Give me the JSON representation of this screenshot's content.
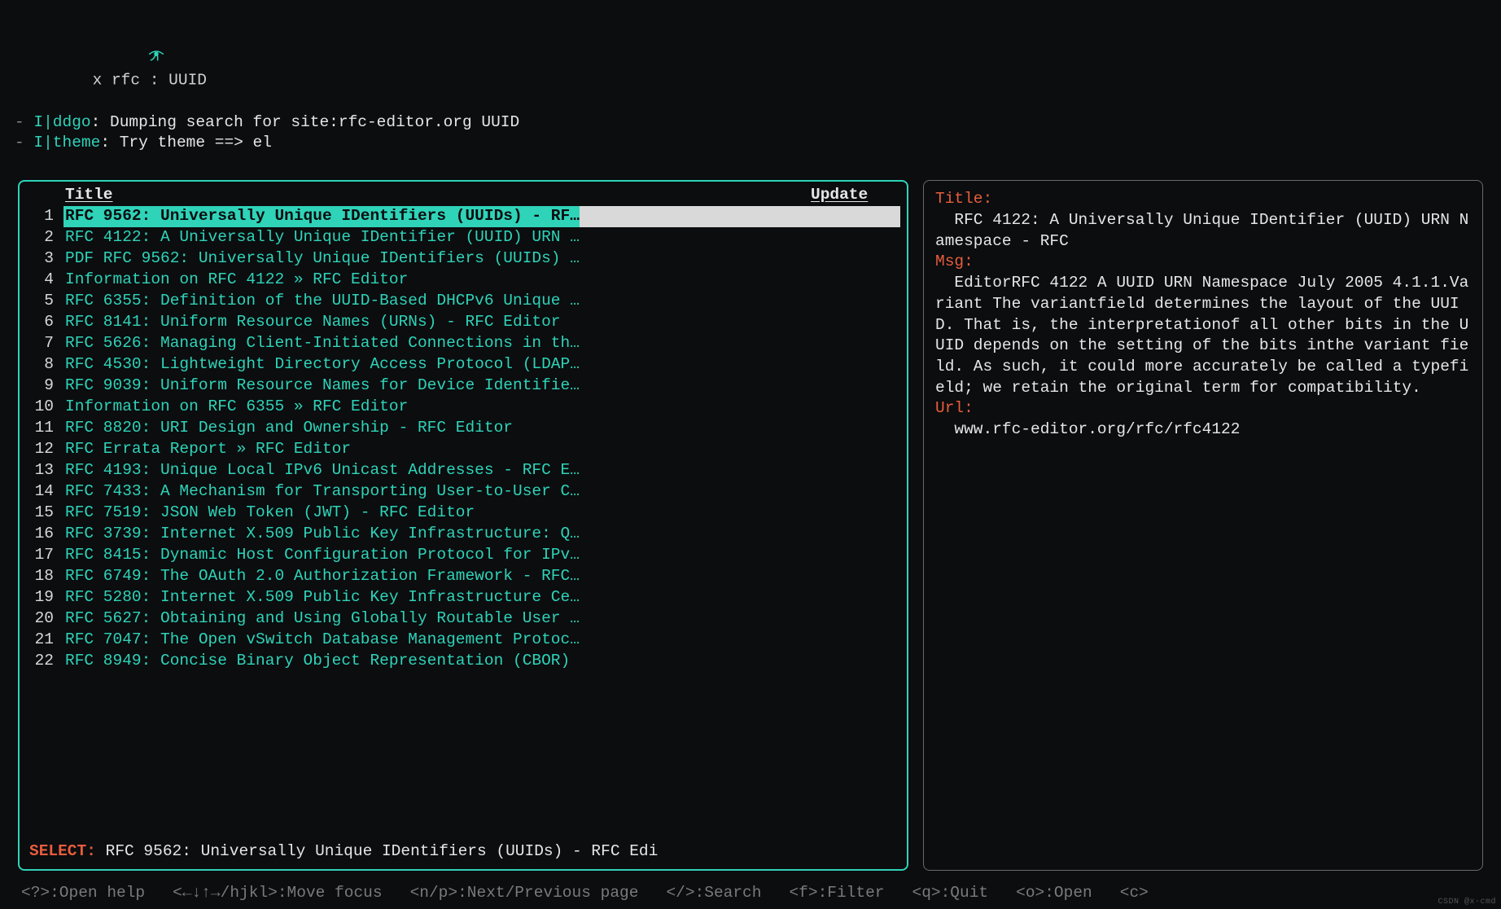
{
  "top": {
    "cmd": "x rfc : UUID",
    "log1_prefix": "- ",
    "log1_tag": "I|ddgo",
    "log1_sep": ": ",
    "log1_msg": "Dumping search for site:rfc-editor.org UUID",
    "log2_prefix": "- ",
    "log2_tag": "I|theme",
    "log2_sep": ": ",
    "log2_msg": "Try theme ==> el"
  },
  "list": {
    "header_title": "Title",
    "header_update": "Update",
    "selected_index": 0,
    "rows": [
      {
        "n": "1",
        "t": "RFC 9562: Universally Unique IDentifiers (UUIDs) - RF…"
      },
      {
        "n": "2",
        "t": "RFC 4122: A Universally Unique IDentifier (UUID) URN …"
      },
      {
        "n": "3",
        "t": "PDF RFC 9562: Universally Unique IDentifiers (UUIDs) …"
      },
      {
        "n": "4",
        "t": "Information on RFC 4122 » RFC Editor"
      },
      {
        "n": "5",
        "t": "RFC 6355: Definition of the UUID-Based DHCPv6 Unique …"
      },
      {
        "n": "6",
        "t": "RFC 8141: Uniform Resource Names (URNs) - RFC Editor"
      },
      {
        "n": "7",
        "t": "RFC 5626: Managing Client-Initiated Connections in th…"
      },
      {
        "n": "8",
        "t": "RFC 4530: Lightweight Directory Access Protocol (LDAP…"
      },
      {
        "n": "9",
        "t": "RFC 9039: Uniform Resource Names for Device Identifie…"
      },
      {
        "n": "10",
        "t": "Information on RFC 6355 » RFC Editor"
      },
      {
        "n": "11",
        "t": "RFC 8820: URI Design and Ownership - RFC Editor"
      },
      {
        "n": "12",
        "t": "RFC Errata Report » RFC Editor"
      },
      {
        "n": "13",
        "t": "RFC 4193: Unique Local IPv6 Unicast Addresses - RFC E…"
      },
      {
        "n": "14",
        "t": "RFC 7433: A Mechanism for Transporting User-to-User C…"
      },
      {
        "n": "15",
        "t": "RFC 7519: JSON Web Token (JWT) - RFC Editor"
      },
      {
        "n": "16",
        "t": "RFC 3739: Internet X.509 Public Key Infrastructure: Q…"
      },
      {
        "n": "17",
        "t": "RFC 8415: Dynamic Host Configuration Protocol for IPv…"
      },
      {
        "n": "18",
        "t": "RFC 6749: The OAuth 2.0 Authorization Framework - RFC…"
      },
      {
        "n": "19",
        "t": "RFC 5280: Internet X.509 Public Key Infrastructure Ce…"
      },
      {
        "n": "20",
        "t": "RFC 5627: Obtaining and Using Globally Routable User …"
      },
      {
        "n": "21",
        "t": "RFC 7047: The Open vSwitch Database Management Protoc…"
      },
      {
        "n": "22",
        "t": "RFC 8949: Concise Binary Object Representation (CBOR)"
      }
    ],
    "select_label": "SELECT",
    "select_value": "RFC 9562: Universally Unique IDentifiers (UUIDs) - RFC Edi"
  },
  "detail": {
    "title_label": "Title",
    "title_value": "RFC 4122: A Universally Unique IDentifier (UUID) URN Namespace - RFC",
    "msg_label": "Msg",
    "msg_value": "EditorRFC 4122 A UUID URN Namespace July 2005 4.1.1.Variant The variantfield determines the layout of the UUID. That is, the interpretationof all other bits in the UUID depends on the setting of the bits inthe variant field. As such, it could more accurately be called a typefield; we retain the original term for compatibility.",
    "url_label": "Url",
    "url_value": "www.rfc-editor.org/rfc/rfc4122"
  },
  "footer": {
    "help": "<?>:Open help",
    "move": "<←↓↑→/hjkl>:Move focus",
    "page": "<n/p>:Next/Previous page",
    "search": "</>:Search",
    "filter": "<f>:Filter",
    "quit": "<q>:Quit",
    "open": "<o>:Open",
    "c": "<c>"
  },
  "watermark": "CSDN @x-cmd"
}
